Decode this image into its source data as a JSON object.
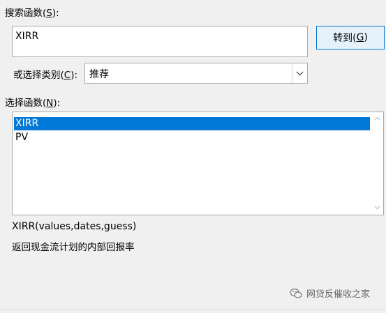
{
  "search": {
    "label_prefix": "搜索函数(",
    "label_key": "S",
    "label_suffix": "):",
    "value": "XIRR"
  },
  "goto_button": {
    "prefix": "转到(",
    "key": "G",
    "suffix": ")"
  },
  "category": {
    "label_prefix": "或选择类别(",
    "label_key": "C",
    "label_suffix": "):",
    "selected": "推荐"
  },
  "function_list": {
    "label_prefix": "选择函数(",
    "label_key": "N",
    "label_suffix": "):",
    "items": [
      "XIRR",
      "PV"
    ],
    "selected_index": 0
  },
  "signature": "XIRR(values,dates,guess)",
  "description": "返回现金流计划的内部回报率",
  "watermark": "网贷反催收之家",
  "colors": {
    "accent": "#0078d7",
    "button_bg": "#e5f1fb",
    "dialog_bg": "#f0f0f0",
    "border": "#a9a9a9"
  },
  "icons": {
    "dropdown": "chevron-down-icon",
    "scroll_up": "chevron-up-icon",
    "scroll_down": "chevron-down-icon",
    "watermark": "wechat-icon"
  }
}
